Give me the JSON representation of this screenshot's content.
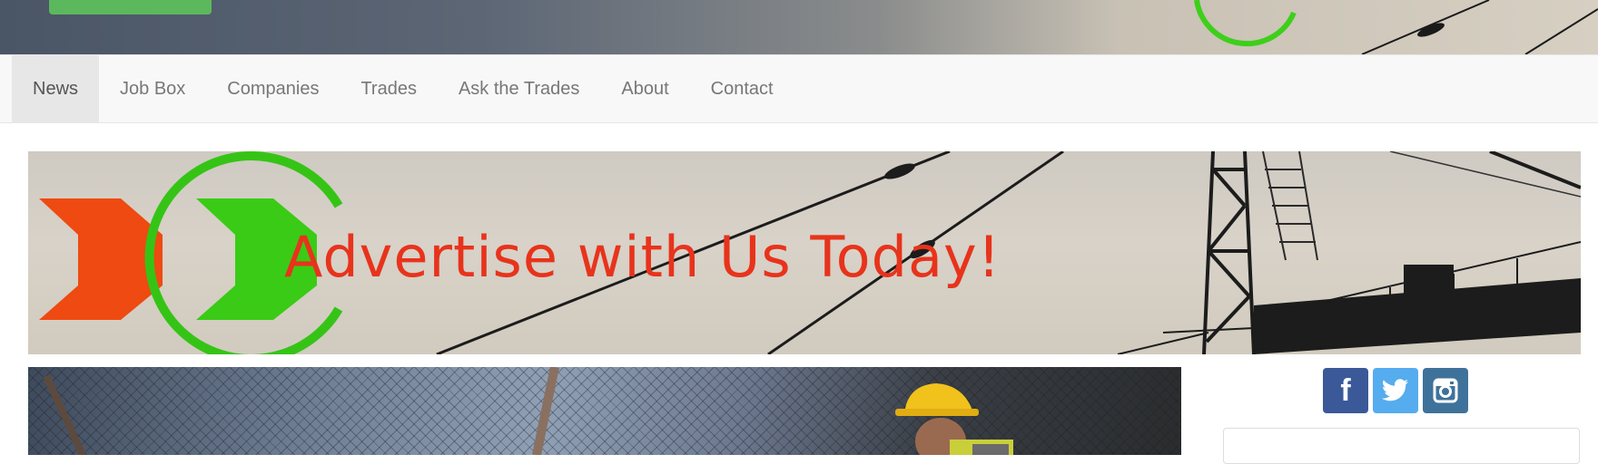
{
  "top_hero": {
    "button_icon": "green-button",
    "logo_icon": "green-arc-logo-icon"
  },
  "nav": {
    "items": [
      {
        "label": "News",
        "active": true
      },
      {
        "label": "Job Box",
        "active": false
      },
      {
        "label": "Companies",
        "active": false
      },
      {
        "label": "Trades",
        "active": false
      },
      {
        "label": "Ask the Trades",
        "active": false
      },
      {
        "label": "About",
        "active": false
      },
      {
        "label": "Contact",
        "active": false
      }
    ]
  },
  "ad_banner": {
    "text": "Advertise with Us Today!",
    "logo_icon": "wrench-logo-icon",
    "background_icon": "crane-silhouette-icon",
    "text_color": "#e8331c"
  },
  "social": [
    {
      "name": "facebook-icon",
      "color": "#3b5998"
    },
    {
      "name": "twitter-icon",
      "color": "#55acee"
    },
    {
      "name": "instagram-icon",
      "color": "#3f729b"
    }
  ],
  "colors": {
    "nav_background": "#f8f8f8",
    "nav_active": "#e7e7e7",
    "nav_text": "#777777",
    "green": "#5cb85c"
  }
}
